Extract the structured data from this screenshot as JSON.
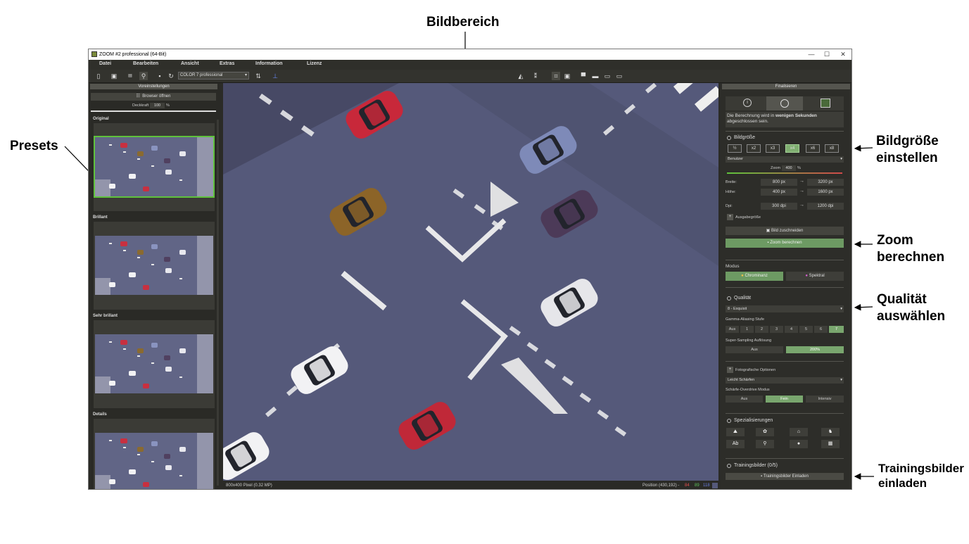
{
  "annotations": {
    "bildbereich": "Bildbereich",
    "presets": "Presets",
    "bildgroesse_1": "Bildgröße",
    "bildgroesse_2": "einstellen",
    "zoom_1": "Zoom",
    "zoom_2": "berechnen",
    "qualitaet_1": "Qualität",
    "qualitaet_2": "auswählen",
    "training_1": "Trainingsbilder",
    "training_2": "einladen"
  },
  "window": {
    "title": "ZOOM #2 professional (64-Bit)",
    "minimize": "—",
    "maximize": "☐",
    "close": "✕"
  },
  "menu": [
    "Datei",
    "Bearbeiten",
    "Ansicht",
    "Extras",
    "Information",
    "Lizenz"
  ],
  "toolbar": {
    "profile": "COLOR 7 professional"
  },
  "left_panel": {
    "header": "Voreinstellungen",
    "browser_button": "Browser öffnen",
    "opacity_label": "Deckkraft",
    "opacity_value": "100",
    "opacity_unit": "%",
    "presets": [
      {
        "label": "Original",
        "selected": true
      },
      {
        "label": "Brillant",
        "selected": false
      },
      {
        "label": "Sehr brillant",
        "selected": false
      },
      {
        "label": "Details",
        "selected": false
      }
    ]
  },
  "status": {
    "size": "800x400 Pixel (0.32 MP)",
    "position": "Position  (430,192) -",
    "r": "84",
    "g": "89",
    "b": "118",
    "r_color": "#e05050",
    "g_color": "#5cc05c",
    "b_color": "#6a7fe0"
  },
  "right_panel": {
    "header": "Finalisieren",
    "info_prefix": "Die Berechnung wird in ",
    "info_bold": "wenigen Sekunden",
    "info_suffix": "abgeschlossen sein.",
    "bildgroesse_title": "Bildgröße",
    "size_buttons": [
      "½",
      "x2",
      "x3",
      "x4",
      "x6",
      "x8"
    ],
    "size_selected_index": 3,
    "preset_select": "Benutzer",
    "zoom_label": "Zoom",
    "zoom_value": "400",
    "zoom_unit": "%",
    "breite_label": "Breite:",
    "breite_from": "800 px",
    "breite_to": "3200 px",
    "hoehe_label": "Höhe:",
    "hoehe_from": "400 px",
    "hoehe_to": "1600 px",
    "dpi_label": "Dpi:",
    "dpi_from": "300 dpi",
    "dpi_to": "1200 dpi",
    "arrow": "→",
    "ausgabegroesse": "Ausgabegröße",
    "crop_button": "Bild zuschneiden",
    "zoom_button": "Zoom berechnen",
    "modus_label": "Modus",
    "chrominanz": "Chrominanz",
    "spektral": "Spektral",
    "qualitaet_title": "Qualität",
    "quality_select": "8 - Exquisit",
    "gamma_label": "Gamma-Aliasing Stufe",
    "gamma_options": [
      "Aus",
      "1",
      "2",
      "3",
      "4",
      "5",
      "6",
      "7"
    ],
    "gamma_selected_index": 7,
    "ss_label": "Super-Sampling Auflösung",
    "ss_options": [
      "Aus",
      "200%"
    ],
    "ss_selected_index": 1,
    "foto_label": "Fotografische Optionen",
    "sharp_select": "Leicht Schärfen",
    "overdrive_label": "Schärfe-Overdrive Modus",
    "overdrive_options": [
      "Aus",
      "Fein",
      "Intensiv"
    ],
    "overdrive_selected_index": 1,
    "spez_title": "Spezialisierungen",
    "spez_icons": [
      "landscape-icon",
      "flower-icon",
      "architecture-icon",
      "animal-icon",
      "text-icon",
      "pin-icon",
      "person-icon",
      "grid-icon"
    ],
    "training_title": "Trainingsbilder (0/5)",
    "training_button": "Trainingsbilder Einladen"
  }
}
